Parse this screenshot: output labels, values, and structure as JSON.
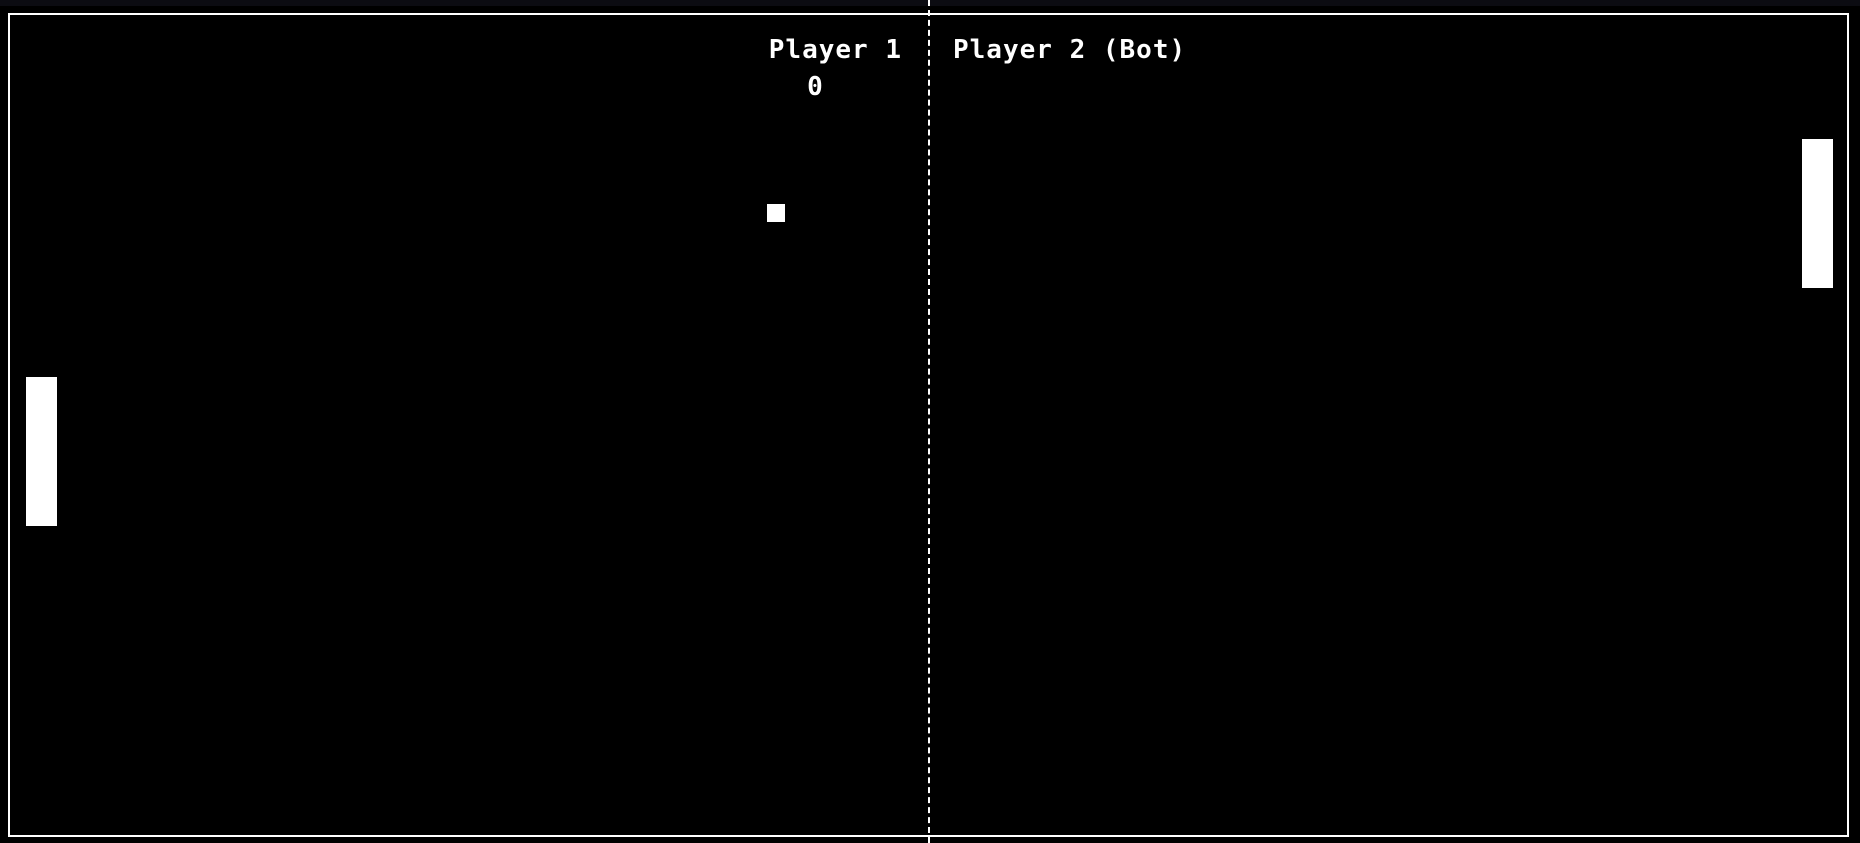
{
  "game": {
    "player1": {
      "label": "Player 1",
      "score": "0"
    },
    "player2": {
      "label": "Player 2 (Bot)"
    }
  },
  "colors": {
    "background": "#000000",
    "foreground": "#ffffff"
  }
}
